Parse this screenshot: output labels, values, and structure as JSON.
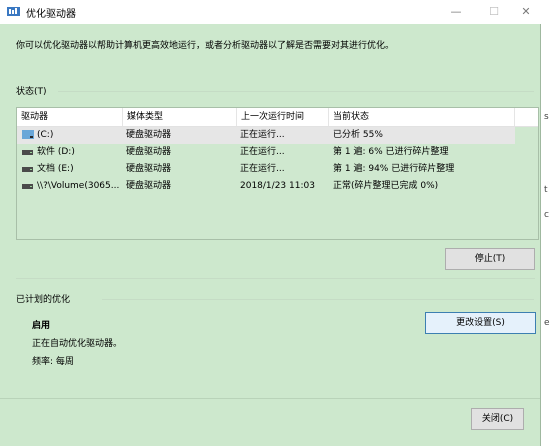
{
  "window": {
    "title": "优化驱动器",
    "minimize_label": "—",
    "maximize_label": "☐",
    "close_label": "✕"
  },
  "description": "你可以优化驱动器以帮助计算机更高效地运行，或者分析驱动器以了解是否需要对其进行优化。",
  "status_section": {
    "label": "状态(T)",
    "columns": [
      "驱动器",
      "媒体类型",
      "上一次运行时间",
      "当前状态"
    ],
    "rows": [
      {
        "drive": "(C:)",
        "media": "硬盘驱动器",
        "last_run": "正在运行...",
        "status": "已分析 55%",
        "icon": "system-drive-icon"
      },
      {
        "drive": "软件 (D:)",
        "media": "硬盘驱动器",
        "last_run": "正在运行...",
        "status": "第 1 遍: 6% 已进行碎片整理",
        "icon": "hard-drive-icon"
      },
      {
        "drive": "文档 (E:)",
        "media": "硬盘驱动器",
        "last_run": "正在运行...",
        "status": "第 1 遍: 94% 已进行碎片整理",
        "icon": "hard-drive-icon"
      },
      {
        "drive": "\\\\?\\Volume(3065...",
        "media": "硬盘驱动器",
        "last_run": "2018/1/23 11:03",
        "status": "正常(碎片整理已完成 0%)",
        "icon": "hard-drive-icon"
      }
    ],
    "stop_button": "停止(T)"
  },
  "scheduled_section": {
    "label": "已计划的优化",
    "state": "启用",
    "detail": "正在自动优化驱动器。",
    "frequency": "频率: 每周",
    "change_button": "更改设置(S)"
  },
  "close_button": "关闭(C)",
  "background_fragments": [
    "s",
    "t",
    "c",
    "e"
  ]
}
